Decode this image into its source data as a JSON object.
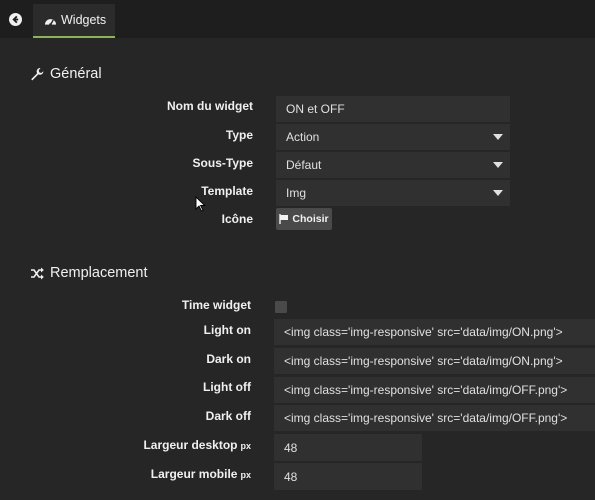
{
  "tab": {
    "label": "Widgets",
    "icon": "dashboard-icon"
  },
  "general": {
    "title": "Général",
    "icon": "wrench-icon",
    "name_label": "Nom du widget",
    "name_value": "ON et OFF",
    "type_label": "Type",
    "type_value": "Action",
    "subtype_label": "Sous-Type",
    "subtype_value": "Défaut",
    "template_label": "Template",
    "template_value": "Img",
    "icon_label": "Icône",
    "choose_button": "Choisir"
  },
  "replacement": {
    "title": "Remplacement",
    "icon": "shuffle-icon",
    "time_widget_label": "Time widget",
    "time_widget_checked": false,
    "light_on_label": "Light on",
    "light_on_value": "<img class='img-responsive' src='data/img/ON.png'>",
    "dark_on_label": "Dark on",
    "dark_on_value": "<img class='img-responsive' src='data/img/ON.png'>",
    "light_off_label": "Light off",
    "light_off_value": "<img class='img-responsive' src='data/img/OFF.png'>",
    "dark_off_label": "Dark off",
    "dark_off_value": "<img class='img-responsive' src='data/img/OFF.png'>",
    "desktop_width_label": "Largeur desktop",
    "desktop_width_value": "48",
    "mobile_width_label": "Largeur mobile",
    "mobile_width_value": "48",
    "unit": "px"
  },
  "colors": {
    "accent": "#8cb35a",
    "background": "#262626",
    "field": "#303030"
  }
}
